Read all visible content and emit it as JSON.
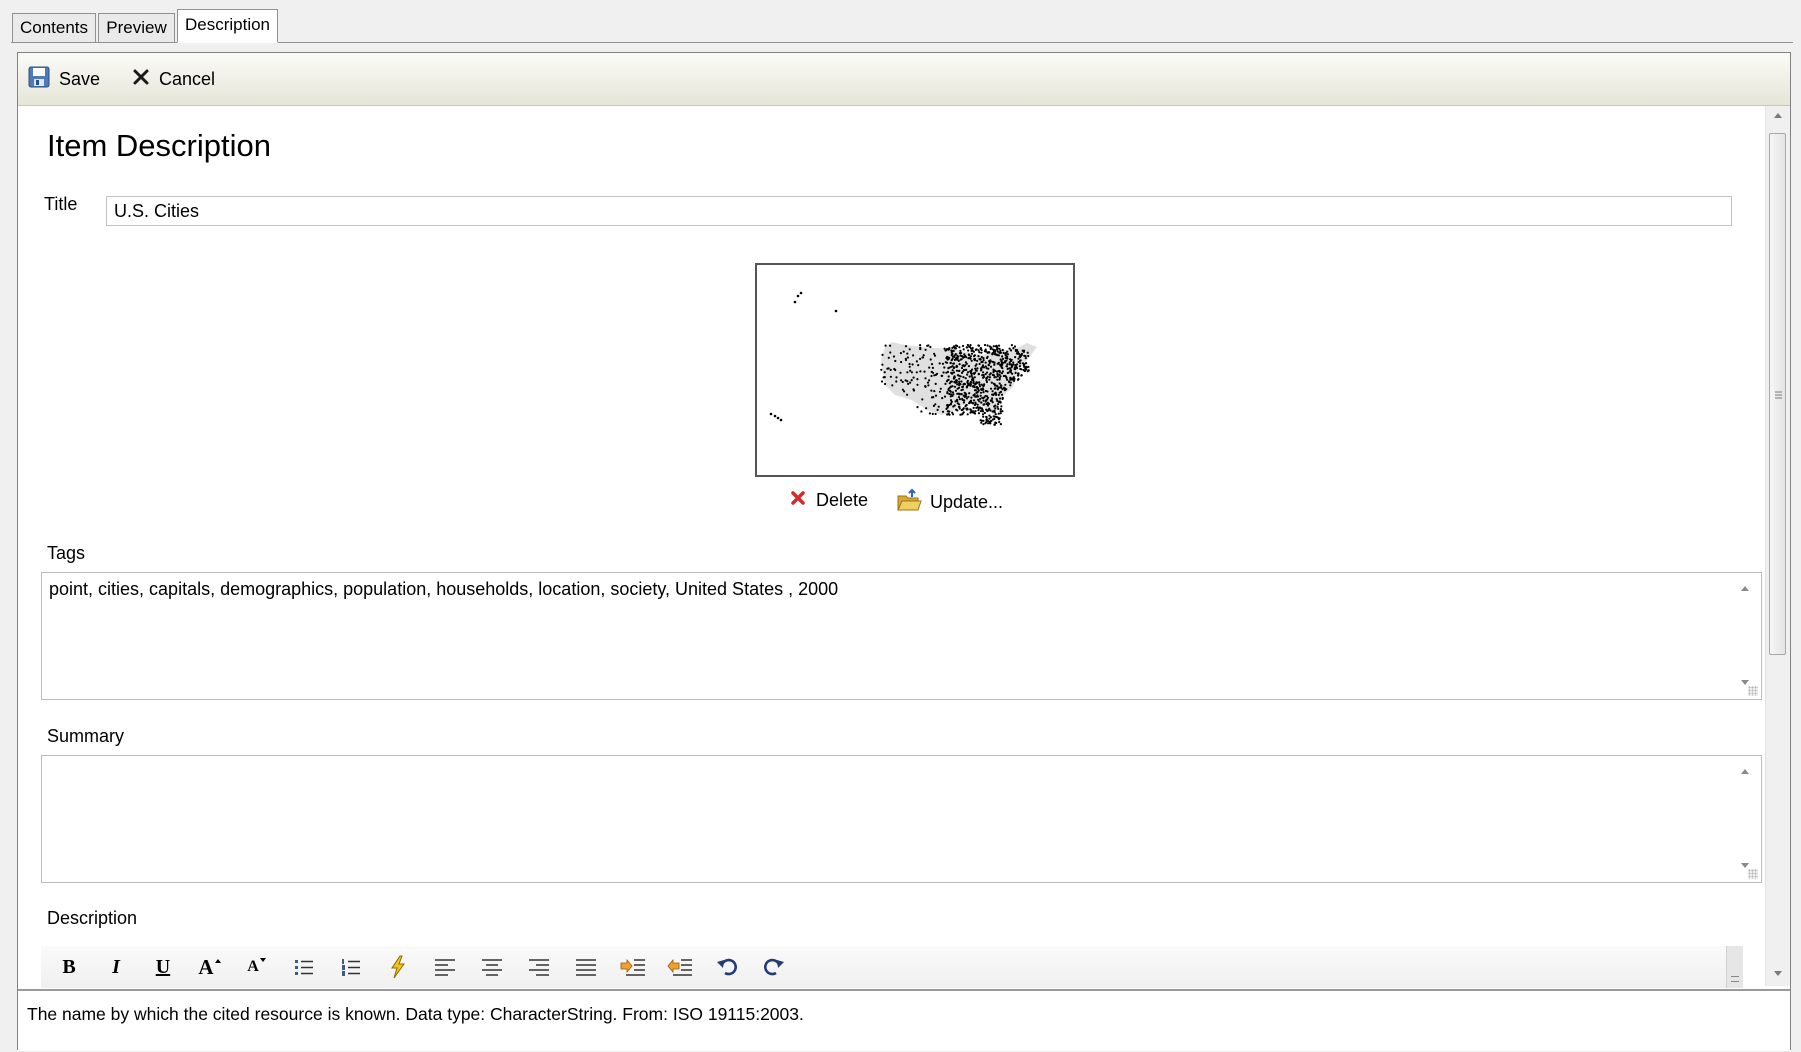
{
  "tabs": [
    {
      "label": "Contents"
    },
    {
      "label": "Preview"
    },
    {
      "label": "Description"
    }
  ],
  "toolbar": {
    "save_label": "Save",
    "cancel_label": "Cancel"
  },
  "form": {
    "heading": "Item Description",
    "title_label": "Title",
    "title_value": "U.S. Cities",
    "thumbnail_actions": {
      "delete_label": "Delete",
      "update_label": "Update..."
    },
    "tags_label": "Tags",
    "tags_value": "point, cities, capitals, demographics, population, households, location, society, United States , 2000",
    "summary_label": "Summary",
    "summary_value": "",
    "description_label": "Description"
  },
  "editor_buttons": [
    {
      "name": "bold",
      "glyph": "B"
    },
    {
      "name": "italic",
      "glyph": "I"
    },
    {
      "name": "underline",
      "glyph": "U"
    },
    {
      "name": "font-size-increase",
      "glyph": "A"
    },
    {
      "name": "font-size-decrease",
      "glyph": "A"
    }
  ],
  "status": {
    "message": "The name by which the cited resource is known. Data type: CharacterString. From: ISO 19115:2003."
  },
  "colors": {
    "toolbar_top": "#fbfbf7",
    "toolbar_bottom": "#e5e5d8",
    "delete_red": "#d22b2b",
    "folder_yellow": "#e8c04a"
  }
}
